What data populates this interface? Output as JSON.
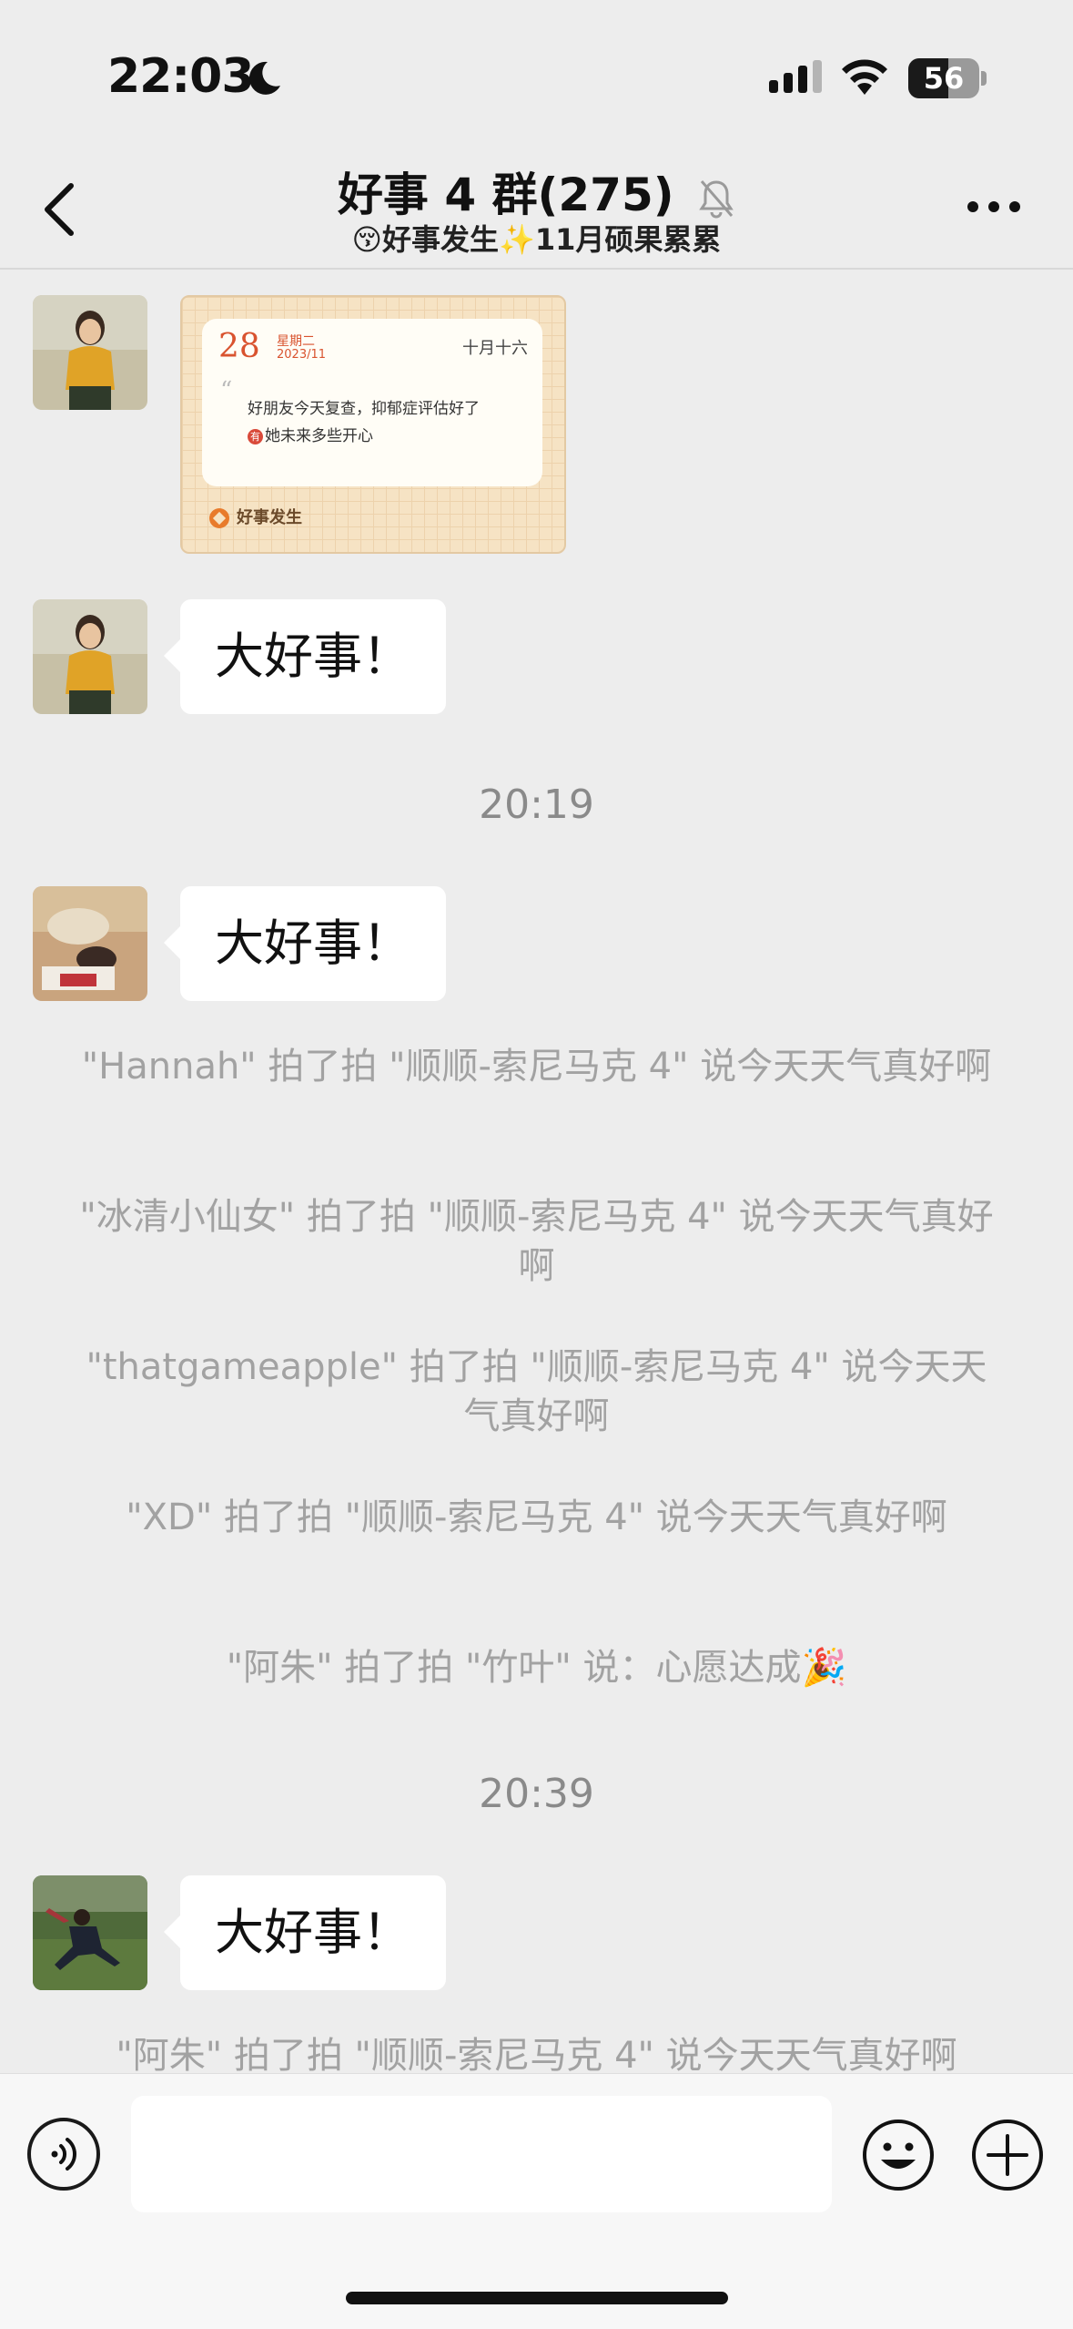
{
  "status_bar": {
    "time": "22:03",
    "battery": "56",
    "battery_level": 0.56,
    "icons": [
      "moon-icon",
      "signal-icon",
      "wifi-icon",
      "battery-icon"
    ]
  },
  "nav": {
    "title": "好事 4 群(275)",
    "subtitle": "😚好事发生✨11月硕果累累",
    "icons": [
      "back-icon",
      "mute-bell-icon",
      "more-icon"
    ]
  },
  "card": {
    "day": "28",
    "weekday": "星期二",
    "date": "2023/11",
    "lunar": "十月十六",
    "line1": "好朋友今天复查，抑郁症评估好了",
    "tag": "🈶",
    "line2": "她未来多些开心",
    "footer": "好事发生"
  },
  "messages": [
    {
      "text": "大好事！"
    },
    {
      "text": "大好事！"
    },
    {
      "text": "大好事！"
    }
  ],
  "time_dividers": [
    "20:19",
    "20:39"
  ],
  "system_messages": [
    "\"Hannah\" 拍了拍 \"顺顺-索尼马克 4\" 说今天天气真好啊",
    "\"冰清小仙女\" 拍了拍 \"顺顺-索尼马克 4\" 说今天天气真好啊",
    "\"thatgameapple\" 拍了拍 \"顺顺-索尼马克 4\" 说今天天气真好啊",
    "\"XD\" 拍了拍 \"顺顺-索尼马克 4\" 说今天天气真好啊",
    "\"阿朱\" 拍了拍 \"竹叶\" 说：心愿达成🎉",
    "\"阿朱\" 拍了拍 \"顺顺-索尼马克 4\" 说今天天气真好啊"
  ],
  "input": {
    "placeholder": "",
    "icons": [
      "voice-icon",
      "emoji-icon",
      "plus-icon"
    ]
  }
}
